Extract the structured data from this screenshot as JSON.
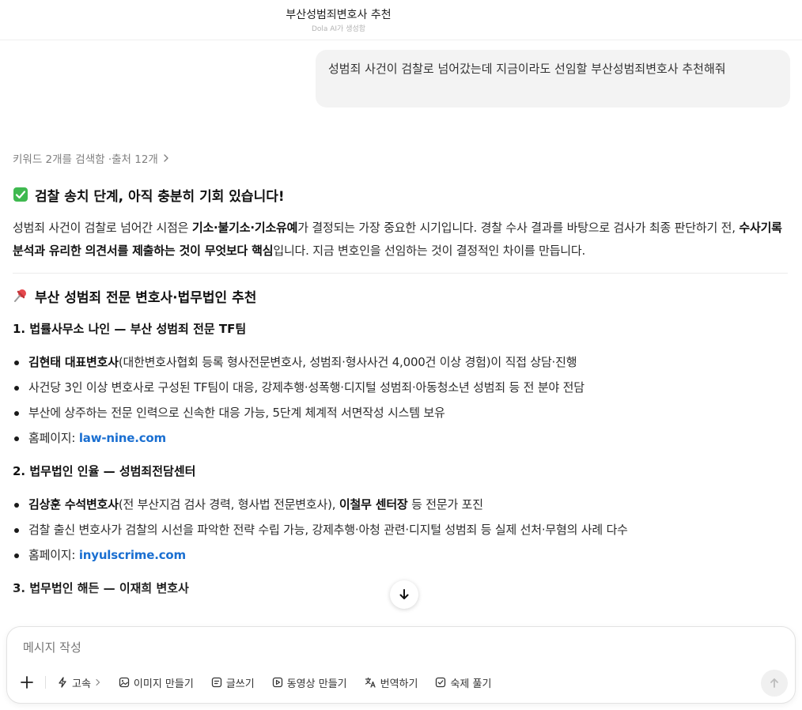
{
  "header": {
    "title": "부산성범죄변호사 추천",
    "subtitle": "Dola AI가 생성함"
  },
  "user_message": "성범죄 사건이 검찰로 넘어갔는데 지금이라도 선임할 부산성범죄변호사 추천해줘",
  "search_meta": "키워드 2개를 검색함 ·출처 12개",
  "answer": {
    "heading1": "검찰 송치 단계, 아직 충분히 기회 있습니다!",
    "para": {
      "t1": "성범죄 사건이 검찰로 넘어간 시점은 ",
      "b1": "기소·불기소·기소유예",
      "t2": "가 결정되는 가장 중요한 시기입니다. 경찰 수사 결과를 바탕으로 검사가 최종 판단하기 전, ",
      "b2": "수사기록 분석과 유리한 의견서를 제출하는 것이 무엇보다 핵심",
      "t3": "입니다. 지금 변호인을 선임하는 것이 결정적인 차이를 만듭니다."
    },
    "heading2": "부산 성범죄 전문 변호사·법무법인 추천",
    "firm1": {
      "title": "1. 법률사무소 나인 — 부산 성범죄 전문 TF팀",
      "b1_bold": "김현태 대표변호사",
      "b1_text": "(대한변호사협회 등록 형사전문변호사, 성범죄·형사사건 4,000건 이상 경험)이 직접 상담·진행",
      "b2": "사건당 3인 이상 변호사로 구성된 TF팀이 대응, 강제추행·성폭행·디지털 성범죄·아동청소년 성범죄 등 전 분야 전담",
      "b3": "부산에 상주하는 전문 인력으로 신속한 대응 가능, 5단계 체계적 서면작성 시스템 보유",
      "hp_label": "홈페이지: ",
      "hp_link": "law-nine.com"
    },
    "firm2": {
      "title": "2. 법무법인 인율 — 성범죄전담센터",
      "b1_bold": "김상훈 수석변호사",
      "b1_text": "(전 부산지검 검사 경력, 형사법 전문변호사), ",
      "b1_bold2": "이철무 센터장",
      "b1_text2": " 등 전문가 포진",
      "b2": "검찰 출신 변호사가 검찰의 시선을 파악한 전략 수립 가능, 강제추행·아청 관련·디지털 성범죄 등 실제 선처·무혐의 사례 다수",
      "hp_label": "홈페이지: ",
      "hp_link": "inyulscrime.com"
    },
    "firm3": {
      "title": "3. 법무법인 해든 — 이재희 변호사"
    }
  },
  "composer": {
    "placeholder": "메시지 작성",
    "tools": {
      "speed": "고속",
      "image": "이미지 만들기",
      "write": "글쓰기",
      "video": "동영상 만들기",
      "translate": "번역하기",
      "homework": "숙제 풀기"
    }
  },
  "colors": {
    "accent_link": "#1a6fd1",
    "check_emoji": "#3fb950",
    "pin_emoji": "#e5484d"
  }
}
